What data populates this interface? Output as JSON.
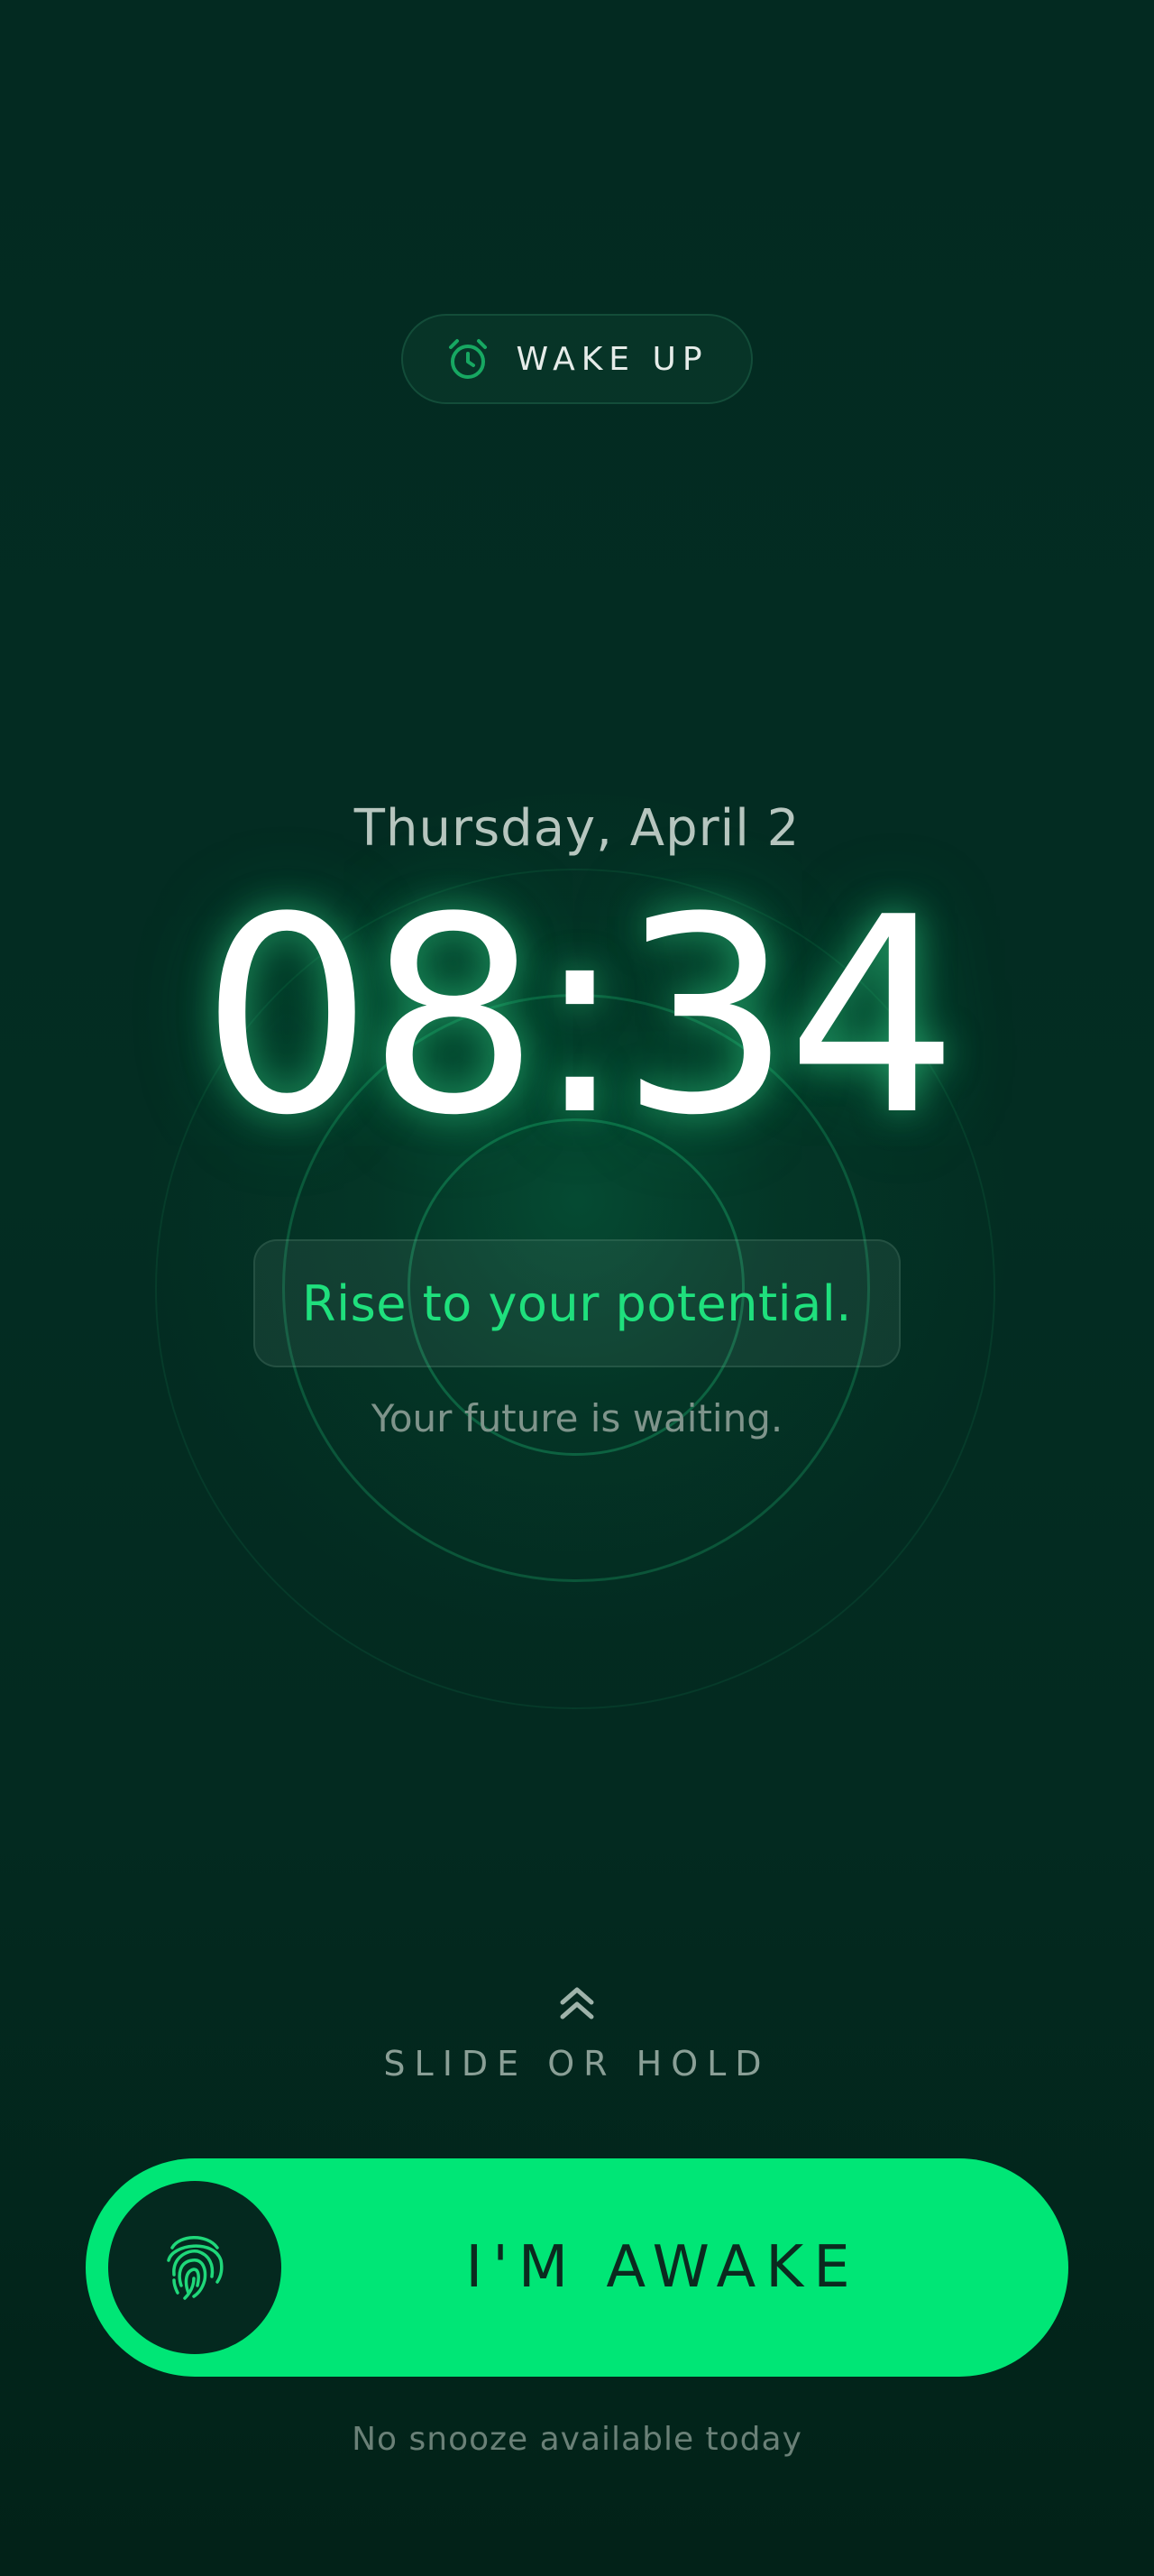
{
  "header": {
    "badge_label": "WAKE UP",
    "badge_icon": "alarm-clock-icon"
  },
  "clock": {
    "date": "Thursday, April 2",
    "time": "08:34"
  },
  "message": {
    "headline": "Rise to your potential.",
    "subline": "Your future is waiting."
  },
  "dismiss": {
    "hint_icon": "double-chevron-up-icon",
    "hint": "SLIDE OR HOLD",
    "slider_label": "I'M AWAKE",
    "knob_icon": "fingerprint-icon",
    "footnote": "No snooze available today"
  },
  "colors": {
    "background": "#032a21",
    "accent": "#00e676",
    "quote_text": "#1fe07d"
  }
}
